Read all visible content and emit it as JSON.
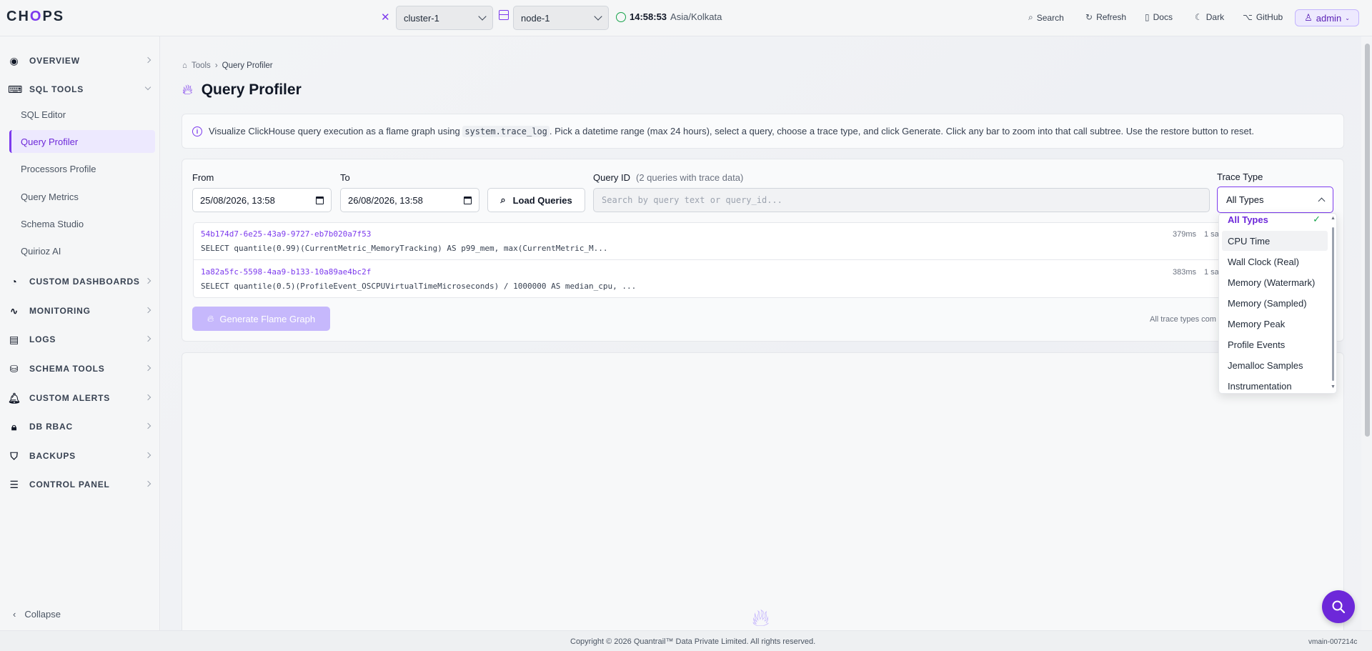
{
  "app": {
    "logo": "CHOPS"
  },
  "topbar": {
    "cluster": "cluster-1",
    "node": "node-1",
    "time": "14:58:53",
    "timezone": "Asia/Kolkata",
    "search": "Search",
    "refresh": "Refresh",
    "docs": "Docs",
    "theme": "Dark",
    "github": "GitHub",
    "user": "admin"
  },
  "sidebar": {
    "sections": [
      {
        "label": "OVERVIEW",
        "icon": "eye-icon"
      },
      {
        "label": "SQL TOOLS",
        "icon": "terminal-icon",
        "expanded": true
      },
      {
        "label": "CUSTOM DASHBOARDS",
        "icon": "pie-chart-icon"
      },
      {
        "label": "MONITORING",
        "icon": "activity-icon"
      },
      {
        "label": "LOGS",
        "icon": "file-icon"
      },
      {
        "label": "SCHEMA TOOLS",
        "icon": "database-icon"
      },
      {
        "label": "CUSTOM ALERTS",
        "icon": "bell-icon"
      },
      {
        "label": "DB RBAC",
        "icon": "lock-icon"
      },
      {
        "label": "BACKUPS",
        "icon": "shield-icon"
      },
      {
        "label": "CONTROL PANEL",
        "icon": "sliders-icon"
      }
    ],
    "sql_items": [
      "SQL Editor",
      "Query Profiler",
      "Processors Profile",
      "Query Metrics",
      "Schema Studio",
      "Quirioz AI"
    ],
    "active_item": "Query Profiler",
    "collapse": "Collapse"
  },
  "page": {
    "breadcrumb_root": "Tools",
    "breadcrumb_current": "Query Profiler",
    "title": "Query Profiler",
    "info_pre": "Visualize ClickHouse query execution as a flame graph using",
    "info_code": "system.trace_log",
    "info_post": ". Pick a datetime range (max 24 hours), select a query, choose a trace type, and click Generate. Click any bar to zoom into that call subtree. Use the restore button to reset."
  },
  "form": {
    "from_label": "From",
    "from_value": "25/08/2026, 13:58",
    "to_label": "To",
    "to_value": "26/08/2026, 13:58",
    "load_button": "Load Queries",
    "query_id_label": "Query ID",
    "query_count": "(2 queries with trace data)",
    "search_placeholder": "Search by query text or query_id...",
    "trace_type_label": "Trace Type",
    "trace_type_value": "All Types",
    "generate_button": "Generate Flame Graph",
    "all_types_note": "All trace types com"
  },
  "queries": [
    {
      "id": "54b174d7-6e25-43a9-9727-eb7b020a7f53",
      "sql": "SELECT quantile(0.99)(CurrentMetric_MemoryTracking) AS p99_mem, max(CurrentMetric_M...",
      "duration": "379ms",
      "samples": "1 sa"
    },
    {
      "id": "1a82a5fc-5598-4aa9-b133-10a89ae4bc2f",
      "sql": "SELECT quantile(0.5)(ProfileEvent_OSCPUVirtualTimeMicroseconds) / 1000000 AS median_cpu, ...",
      "duration": "383ms",
      "samples": "1 sa"
    }
  ],
  "dropdown": {
    "options": [
      "All Types",
      "CPU Time",
      "Wall Clock (Real)",
      "Memory (Watermark)",
      "Memory (Sampled)",
      "Memory Peak",
      "Profile Events",
      "Jemalloc Samples",
      "Instrumentation"
    ],
    "selected": "All Types",
    "hovered": "CPU Time"
  },
  "footer": {
    "copyright": "Copyright © 2026 Quantrail™ Data Private Limited. All rights reserved.",
    "version": "vmain-007214c"
  },
  "colors": {
    "accent": "#7c3aed",
    "accent_light": "#ede9fe",
    "ok": "#16a34a"
  }
}
